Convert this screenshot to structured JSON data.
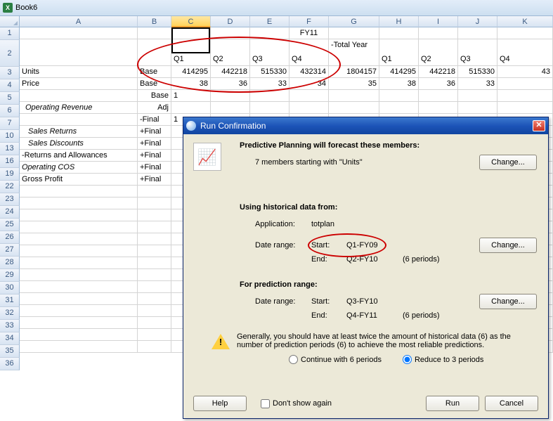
{
  "window": {
    "title": "Book6"
  },
  "columns": [
    "A",
    "B",
    "C",
    "D",
    "E",
    "F",
    "G",
    "H",
    "I",
    "J",
    "K"
  ],
  "rows_shown": [
    "1",
    "2",
    "3",
    "4",
    "5",
    "6",
    "7",
    "10",
    "13",
    "16",
    "19",
    "22",
    "23",
    "24",
    "25",
    "26",
    "27",
    "28",
    "29",
    "30",
    "31",
    "32",
    "33",
    "34",
    "35",
    "36"
  ],
  "year_header": "FY11",
  "quarter_headers": {
    "c": "Q1",
    "d": "Q2",
    "e": "Q3",
    "f": "Q4",
    "g": "-Total Year",
    "h": "Q1",
    "i": "Q2",
    "j": "Q3",
    "k": "Q4"
  },
  "rows": {
    "r3": {
      "a": "Units",
      "b": "Base",
      "c": "414295",
      "d": "442218",
      "e": "515330",
      "f": "432314",
      "g": "1804157",
      "h": "414295",
      "i": "442218",
      "j": "515330",
      "k": "43"
    },
    "r4": {
      "a": "Price",
      "b": "Base",
      "c": "38",
      "d": "36",
      "e": "33",
      "f": "34",
      "g": "35",
      "h": "38",
      "i": "36",
      "j": "33"
    },
    "r5": {
      "b": "Base",
      "c": "1"
    },
    "r6": {
      "a": "Operating Revenue",
      "b": "Adj"
    },
    "r7": {
      "b": "-Final",
      "c": "1"
    },
    "r10": {
      "a": "Sales Returns",
      "b": "+Final"
    },
    "r13": {
      "a": "Sales Discounts",
      "b": "+Final"
    },
    "r16": {
      "a": "-Returns and Allowances",
      "b": "+Final"
    },
    "r19": {
      "a": "Operating COS",
      "b": "+Final"
    },
    "r22": {
      "a": "Gross Profit",
      "b": "+Final"
    }
  },
  "dialog": {
    "title": "Run Confirmation",
    "forecast_heading": "Predictive Planning will forecast these members:",
    "members_text": "7 members starting with \"Units\"",
    "change_label": "Change...",
    "historical_heading": "Using historical data from:",
    "application_label": "Application:",
    "application_value": "totplan",
    "date_range_label": "Date range:",
    "start_label": "Start:",
    "end_label": "End:",
    "hist_start": "Q1-FY09",
    "hist_end": "Q2-FY10",
    "hist_periods": "(6 periods)",
    "prediction_heading": "For prediction range:",
    "pred_start": "Q3-FY10",
    "pred_end": "Q4-FY11",
    "pred_periods": "(6 periods)",
    "warning_text": "Generally, you should have at least twice the amount of historical data (6) as the number of prediction periods (6) to achieve the most reliable predictions.",
    "radio_continue": "Continue with 6 periods",
    "radio_reduce": "Reduce to 3 periods",
    "help": "Help",
    "dont_show": "Don't show again",
    "run": "Run",
    "cancel": "Cancel"
  }
}
